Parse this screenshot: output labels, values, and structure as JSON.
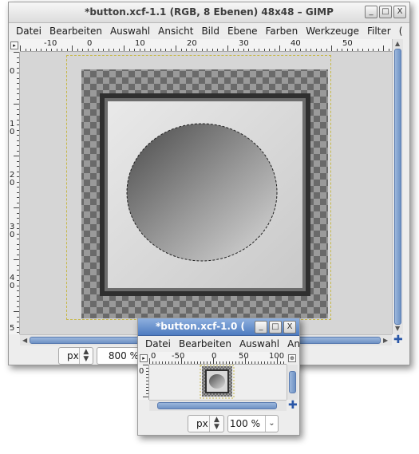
{
  "main_window": {
    "title": "*button.xcf-1.1 (RGB, 8 Ebenen) 48x48 – GIMP",
    "buttons": {
      "minimize": "_",
      "maximize": "□",
      "close": "X"
    },
    "menu": [
      "Datei",
      "Bearbeiten",
      "Auswahl",
      "Ansicht",
      "Bild",
      "Ebene",
      "Farben",
      "Werkzeuge",
      "Filter",
      "("
    ],
    "hruler_labels": [
      "-10",
      "0",
      "10",
      "20",
      "30",
      "40",
      "50"
    ],
    "vruler_labels": [
      "0",
      "1\n0",
      "2\n0",
      "3\n0",
      "4\n0",
      "5"
    ],
    "status": {
      "unit": "px",
      "zoom": "800 %"
    }
  },
  "small_window": {
    "title": "*button.xcf-1.0 (",
    "buttons": {
      "minimize": "_",
      "maximize": "□",
      "close": "X"
    },
    "menu": [
      "Datei",
      "Bearbeiten",
      "Auswahl",
      "An"
    ],
    "hruler_labels": [
      "0",
      "-50",
      "0",
      "50",
      "100"
    ],
    "vruler_labels": [
      "0"
    ],
    "status": {
      "unit": "px",
      "zoom": "100 %"
    }
  },
  "icons": {
    "navigate": "navigate-cross-icon",
    "quick_mask": "quick-mask-icon",
    "zoom_toggle": "zoom-fit-icon"
  },
  "colors": {
    "scroll_accent": "#6f92c4",
    "selection_ants": "#333333",
    "layer_boundary": "#c7b84a"
  }
}
